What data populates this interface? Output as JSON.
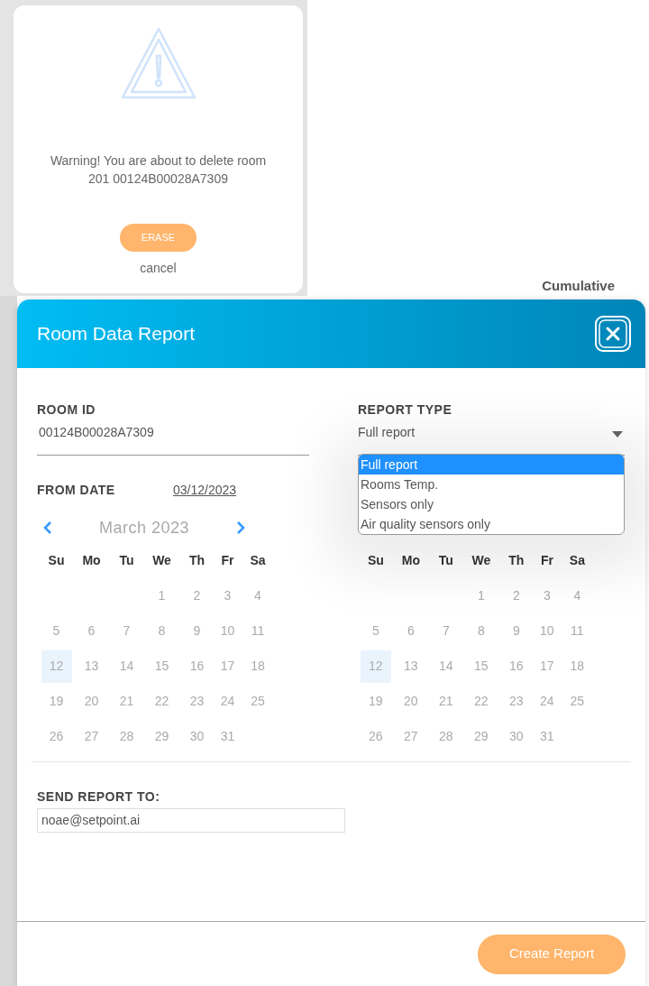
{
  "background": {
    "heading": "Cumulative"
  },
  "warning_dialog": {
    "message": "Warning! You are about to delete room 201 00124B00028A7309",
    "erase_button": "ERASE",
    "cancel_link": "cancel"
  },
  "report_dialog": {
    "title": "Room Data Report",
    "room_id": {
      "label": "ROOM ID",
      "value": "00124B00028A7309"
    },
    "report_type": {
      "label": "REPORT TYPE",
      "value": "Full report",
      "expanded": true,
      "options": [
        {
          "label": "Full report",
          "selected": true
        },
        {
          "label": "Rooms Temp.",
          "selected": false
        },
        {
          "label": "Sensors only",
          "selected": false
        },
        {
          "label": "Air quality sensors only",
          "selected": false
        }
      ]
    },
    "from_date": {
      "label": "FROM DATE",
      "value": "03/12/2023"
    },
    "calendars": [
      {
        "title": "March 2023",
        "weekdays": [
          "Su",
          "Mo",
          "Tu",
          "We",
          "Th",
          "Fr",
          "Sa"
        ],
        "weeks": [
          [
            {
              "kind": "blank"
            },
            {
              "kind": "blank"
            },
            {
              "kind": "blank"
            },
            {
              "kind": "day",
              "day": "1",
              "selected": false
            },
            {
              "kind": "day",
              "day": "2",
              "selected": false
            },
            {
              "kind": "day",
              "day": "3",
              "selected": false
            },
            {
              "kind": "day",
              "day": "4",
              "selected": false
            }
          ],
          [
            {
              "kind": "day",
              "day": "5",
              "selected": false
            },
            {
              "kind": "day",
              "day": "6",
              "selected": false
            },
            {
              "kind": "day",
              "day": "7",
              "selected": false
            },
            {
              "kind": "day",
              "day": "8",
              "selected": false
            },
            {
              "kind": "day",
              "day": "9",
              "selected": false
            },
            {
              "kind": "day",
              "day": "10",
              "selected": false
            },
            {
              "kind": "day",
              "day": "11",
              "selected": false
            }
          ],
          [
            {
              "kind": "day",
              "day": "12",
              "selected": true
            },
            {
              "kind": "day",
              "day": "13",
              "selected": false
            },
            {
              "kind": "day",
              "day": "14",
              "selected": false
            },
            {
              "kind": "day",
              "day": "15",
              "selected": false
            },
            {
              "kind": "day",
              "day": "16",
              "selected": false
            },
            {
              "kind": "day",
              "day": "17",
              "selected": false
            },
            {
              "kind": "day",
              "day": "18",
              "selected": false
            }
          ],
          [
            {
              "kind": "day",
              "day": "19",
              "selected": false
            },
            {
              "kind": "day",
              "day": "20",
              "selected": false
            },
            {
              "kind": "day",
              "day": "21",
              "selected": false
            },
            {
              "kind": "day",
              "day": "22",
              "selected": false
            },
            {
              "kind": "day",
              "day": "23",
              "selected": false
            },
            {
              "kind": "day",
              "day": "24",
              "selected": false
            },
            {
              "kind": "day",
              "day": "25",
              "selected": false
            }
          ],
          [
            {
              "kind": "day",
              "day": "26",
              "selected": false
            },
            {
              "kind": "day",
              "day": "27",
              "selected": false
            },
            {
              "kind": "day",
              "day": "28",
              "selected": false
            },
            {
              "kind": "day",
              "day": "29",
              "selected": false
            },
            {
              "kind": "day",
              "day": "30",
              "selected": false
            },
            {
              "kind": "day",
              "day": "31",
              "selected": false
            },
            {
              "kind": "blank"
            }
          ]
        ]
      },
      {
        "weekdays": [
          "Su",
          "Mo",
          "Tu",
          "We",
          "Th",
          "Fr",
          "Sa"
        ],
        "weeks": [
          [
            {
              "kind": "blank"
            },
            {
              "kind": "blank"
            },
            {
              "kind": "blank"
            },
            {
              "kind": "day",
              "day": "1",
              "selected": false
            },
            {
              "kind": "day",
              "day": "2",
              "selected": false
            },
            {
              "kind": "day",
              "day": "3",
              "selected": false
            },
            {
              "kind": "day",
              "day": "4",
              "selected": false
            }
          ],
          [
            {
              "kind": "day",
              "day": "5",
              "selected": false
            },
            {
              "kind": "day",
              "day": "6",
              "selected": false
            },
            {
              "kind": "day",
              "day": "7",
              "selected": false
            },
            {
              "kind": "day",
              "day": "8",
              "selected": false
            },
            {
              "kind": "day",
              "day": "9",
              "selected": false
            },
            {
              "kind": "day",
              "day": "10",
              "selected": false
            },
            {
              "kind": "day",
              "day": "11",
              "selected": false
            }
          ],
          [
            {
              "kind": "day",
              "day": "12",
              "selected": true
            },
            {
              "kind": "day",
              "day": "13",
              "selected": false
            },
            {
              "kind": "day",
              "day": "14",
              "selected": false
            },
            {
              "kind": "day",
              "day": "15",
              "selected": false
            },
            {
              "kind": "day",
              "day": "16",
              "selected": false
            },
            {
              "kind": "day",
              "day": "17",
              "selected": false
            },
            {
              "kind": "day",
              "day": "18",
              "selected": false
            }
          ],
          [
            {
              "kind": "day",
              "day": "19",
              "selected": false
            },
            {
              "kind": "day",
              "day": "20",
              "selected": false
            },
            {
              "kind": "day",
              "day": "21",
              "selected": false
            },
            {
              "kind": "day",
              "day": "22",
              "selected": false
            },
            {
              "kind": "day",
              "day": "23",
              "selected": false
            },
            {
              "kind": "day",
              "day": "24",
              "selected": false
            },
            {
              "kind": "day",
              "day": "25",
              "selected": false
            }
          ],
          [
            {
              "kind": "day",
              "day": "26",
              "selected": false
            },
            {
              "kind": "day",
              "day": "27",
              "selected": false
            },
            {
              "kind": "day",
              "day": "28",
              "selected": false
            },
            {
              "kind": "day",
              "day": "29",
              "selected": false
            },
            {
              "kind": "day",
              "day": "30",
              "selected": false
            },
            {
              "kind": "day",
              "day": "31",
              "selected": false
            },
            {
              "kind": "blank"
            }
          ]
        ]
      }
    ],
    "send_to": {
      "label": "SEND REPORT TO:",
      "value": "noae@setpoint.ai"
    },
    "create_button": "Create Report"
  }
}
